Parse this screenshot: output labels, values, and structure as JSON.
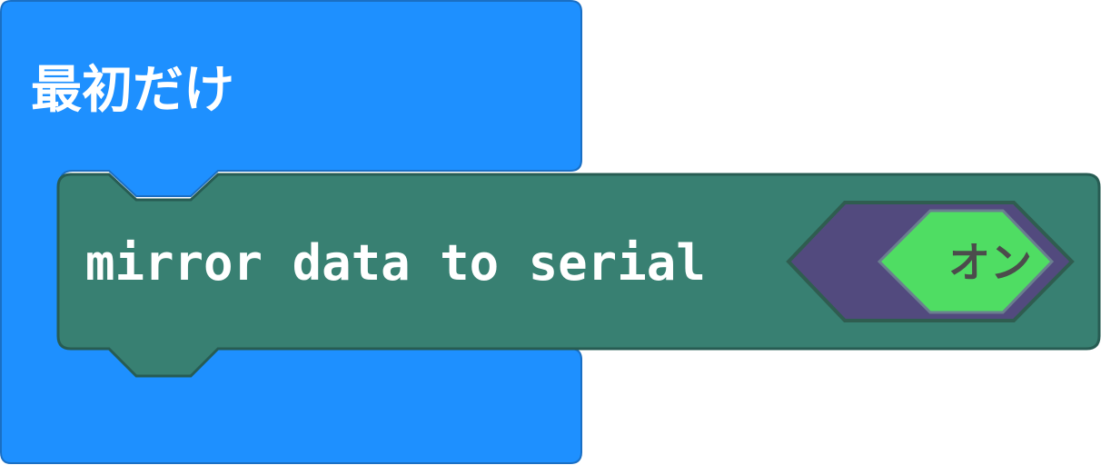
{
  "on_start_block": {
    "label": "最初だけ",
    "color": "#1E90FF",
    "border_color": "#1A6FC4"
  },
  "serial_block": {
    "label": "mirror data to serial",
    "color": "#388072",
    "border_color": "#275C53"
  },
  "toggle": {
    "value_label": "オン",
    "outer_color": "#524A7E",
    "inner_color": "#4FDD63",
    "outline_color": "#2F5D50",
    "text_color": "#4C4C4C"
  }
}
